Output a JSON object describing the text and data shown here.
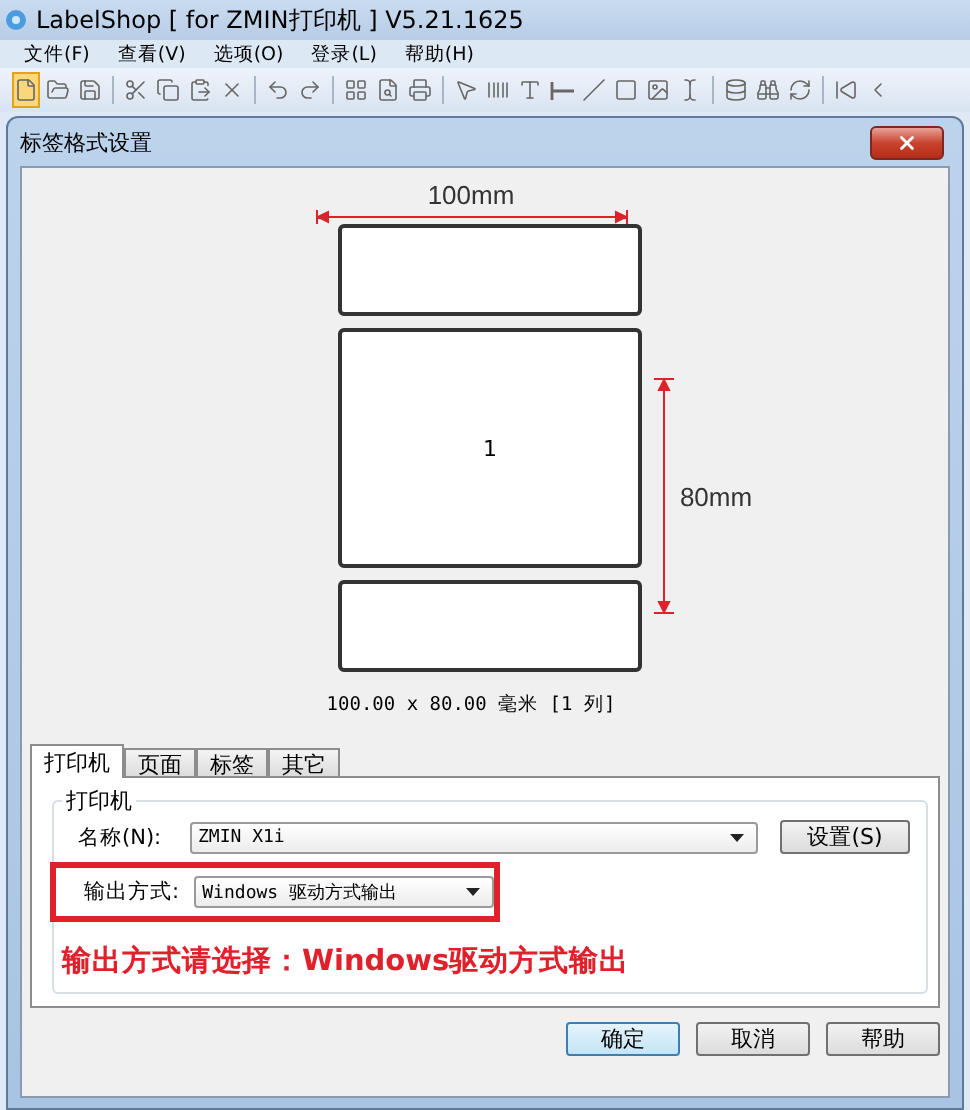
{
  "window": {
    "title": "LabelShop [ for ZMIN打印机 ]  V5.21.1625"
  },
  "menu": [
    "文件(F)",
    "查看(V)",
    "选项(O)",
    "登录(L)",
    "帮助(H)"
  ],
  "dialog": {
    "title": "标签格式设置",
    "preview": {
      "width_label": "100mm",
      "height_label": "80mm",
      "label_number": "1",
      "caption": "100.00 x 80.00 毫米 [1 列]"
    },
    "tabs": [
      {
        "label": "打印机",
        "selected": true
      },
      {
        "label": "页面",
        "selected": false
      },
      {
        "label": "标签",
        "selected": false
      },
      {
        "label": "其它",
        "selected": false
      }
    ],
    "group": {
      "title": "打印机",
      "name_label": "名称(N):",
      "name_value": "ZMIN X1i",
      "settings_button": "设置(S)",
      "output_label": "输出方式:",
      "output_value": "Windows 驱动方式输出"
    },
    "annotation": "输出方式请选择：Windows驱动方式输出",
    "buttons": [
      {
        "label": "确定",
        "default": true
      },
      {
        "label": "取消",
        "default": false
      },
      {
        "label": "帮助",
        "default": false
      }
    ]
  }
}
